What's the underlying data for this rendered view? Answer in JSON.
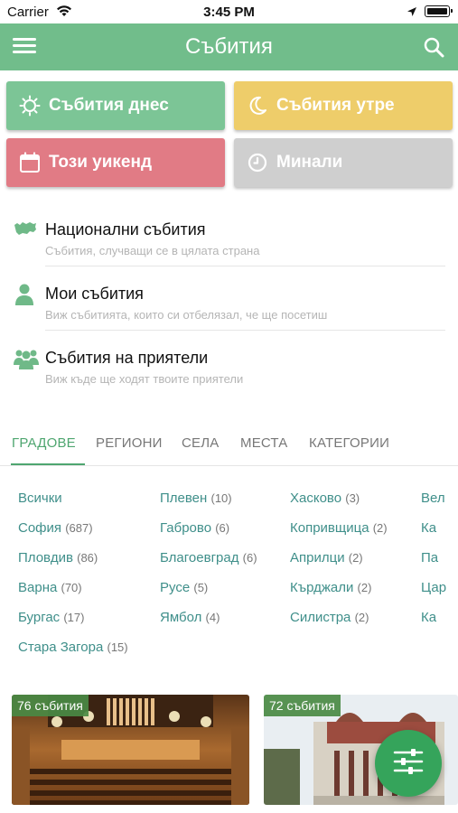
{
  "status_bar": {
    "carrier": "Carrier",
    "time": "3:45 PM"
  },
  "appbar": {
    "title": "Събития"
  },
  "tiles": {
    "today": "Събития днес",
    "tomorrow": "Събития утре",
    "weekend": "Този уикенд",
    "past": "Минали"
  },
  "list": [
    {
      "title": "Национални събития",
      "subtitle": "Събития, случващи се в цялата страна",
      "icon": "bulgaria-map-icon"
    },
    {
      "title": "Мои събития",
      "subtitle": "Виж събитията, които си отбелязал, че ще посетиш",
      "icon": "user-icon"
    },
    {
      "title": "Събития на приятели",
      "subtitle": "Виж къде ще ходят твоите приятели",
      "icon": "friends-icon"
    }
  ],
  "tabs": [
    "ГРАДОВЕ",
    "РЕГИОНИ",
    "СЕЛА",
    "МЕСТА",
    "КАТЕГОРИИ"
  ],
  "active_tab": "ГРАДОВЕ",
  "cities": {
    "col1": [
      {
        "name": "Всички",
        "count": ""
      },
      {
        "name": "София",
        "count": "(687)"
      },
      {
        "name": "Пловдив",
        "count": "(86)"
      },
      {
        "name": "Варна",
        "count": "(70)"
      },
      {
        "name": "Бургас",
        "count": "(17)"
      },
      {
        "name": "Стара Загора",
        "count": "(15)"
      }
    ],
    "col2": [
      {
        "name": "Плевен",
        "count": "(10)"
      },
      {
        "name": "Габрово",
        "count": "(6)"
      },
      {
        "name": "Благоевград",
        "count": "(6)"
      },
      {
        "name": "Русе",
        "count": "(5)"
      },
      {
        "name": "Ямбол",
        "count": "(4)"
      }
    ],
    "col3": [
      {
        "name": "Хасково",
        "count": "(3)"
      },
      {
        "name": "Копривщица",
        "count": "(2)"
      },
      {
        "name": "Априлци",
        "count": "(2)"
      },
      {
        "name": "Кърджали",
        "count": "(2)"
      },
      {
        "name": "Силистра",
        "count": "(2)"
      }
    ],
    "col4": [
      {
        "name": "Вел",
        "count": ""
      },
      {
        "name": "Ка",
        "count": ""
      },
      {
        "name": "Па",
        "count": ""
      },
      {
        "name": "Цар",
        "count": ""
      },
      {
        "name": "Ка",
        "count": ""
      }
    ]
  },
  "cards": [
    {
      "badge": "76 събития"
    },
    {
      "badge": "72 събития"
    }
  ],
  "colors": {
    "primary": "#71bd8b",
    "today": "#7cc596",
    "tomorrow": "#eecd6a",
    "weekend": "#e17b85",
    "past": "#cfcfcf",
    "fab": "#35a45b",
    "link": "#3f8f8a"
  }
}
